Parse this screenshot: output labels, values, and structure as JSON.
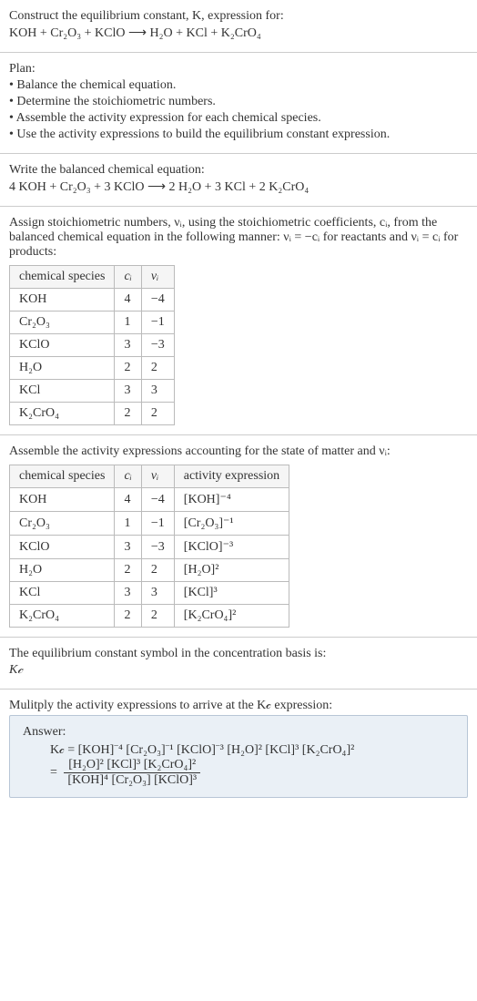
{
  "intro": {
    "line1": "Construct the equilibrium constant, K, expression for:",
    "line2": "KOH + Cr₂O₃ + KClO ⟶ H₂O + KCl + K₂CrO₄"
  },
  "plan": {
    "heading": "Plan:",
    "b1": "• Balance the chemical equation.",
    "b2": "• Determine the stoichiometric numbers.",
    "b3": "• Assemble the activity expression for each chemical species.",
    "b4": "• Use the activity expressions to build the equilibrium constant expression."
  },
  "balanced": {
    "heading": "Write the balanced chemical equation:",
    "eq": "4 KOH + Cr₂O₃ + 3 KClO ⟶ 2 H₂O + 3 KCl + 2 K₂CrO₄"
  },
  "assign": {
    "text": "Assign stoichiometric numbers, νᵢ, using the stoichiometric coefficients, cᵢ, from the balanced chemical equation in the following manner: νᵢ = −cᵢ for reactants and νᵢ = cᵢ for products:",
    "h_species": "chemical species",
    "h_c": "cᵢ",
    "h_v": "νᵢ",
    "r0s": "KOH",
    "r0c": "4",
    "r0v": "−4",
    "r1s": "Cr₂O₃",
    "r1c": "1",
    "r1v": "−1",
    "r2s": "KClO",
    "r2c": "3",
    "r2v": "−3",
    "r3s": "H₂O",
    "r3c": "2",
    "r3v": "2",
    "r4s": "KCl",
    "r4c": "3",
    "r4v": "3",
    "r5s": "K₂CrO₄",
    "r5c": "2",
    "r5v": "2"
  },
  "activities": {
    "heading": "Assemble the activity expressions accounting for the state of matter and νᵢ:",
    "h_species": "chemical species",
    "h_c": "cᵢ",
    "h_v": "νᵢ",
    "h_a": "activity expression",
    "r0s": "KOH",
    "r0c": "4",
    "r0v": "−4",
    "r0a": "[KOH]⁻⁴",
    "r1s": "Cr₂O₃",
    "r1c": "1",
    "r1v": "−1",
    "r1a": "[Cr₂O₃]⁻¹",
    "r2s": "KClO",
    "r2c": "3",
    "r2v": "−3",
    "r2a": "[KClO]⁻³",
    "r3s": "H₂O",
    "r3c": "2",
    "r3v": "2",
    "r3a": "[H₂O]²",
    "r4s": "KCl",
    "r4c": "3",
    "r4v": "3",
    "r4a": "[KCl]³",
    "r5s": "K₂CrO₄",
    "r5c": "2",
    "r5v": "2",
    "r5a": "[K₂CrO₄]²"
  },
  "symbol": {
    "line1": "The equilibrium constant symbol in the concentration basis is:",
    "line2": "K𝒸"
  },
  "multiply": {
    "heading": "Mulitply the activity expressions to arrive at the K𝒸 expression:"
  },
  "answer": {
    "label": "Answer:",
    "line1": "K𝒸 = [KOH]⁻⁴ [Cr₂O₃]⁻¹ [KClO]⁻³ [H₂O]² [KCl]³ [K₂CrO₄]²",
    "eq": "=",
    "num": "[H₂O]² [KCl]³ [K₂CrO₄]²",
    "den": "[KOH]⁴ [Cr₂O₃] [KClO]³"
  },
  "chart_data": {
    "type": "table",
    "tables": [
      {
        "title": "stoichiometric numbers",
        "columns": [
          "chemical species",
          "c_i",
          "ν_i"
        ],
        "rows": [
          [
            "KOH",
            4,
            -4
          ],
          [
            "Cr2O3",
            1,
            -1
          ],
          [
            "KClO",
            3,
            -3
          ],
          [
            "H2O",
            2,
            2
          ],
          [
            "KCl",
            3,
            3
          ],
          [
            "K2CrO4",
            2,
            2
          ]
        ]
      },
      {
        "title": "activity expressions",
        "columns": [
          "chemical species",
          "c_i",
          "ν_i",
          "activity expression"
        ],
        "rows": [
          [
            "KOH",
            4,
            -4,
            "[KOH]^-4"
          ],
          [
            "Cr2O3",
            1,
            -1,
            "[Cr2O3]^-1"
          ],
          [
            "KClO",
            3,
            -3,
            "[KClO]^-3"
          ],
          [
            "H2O",
            2,
            2,
            "[H2O]^2"
          ],
          [
            "KCl",
            3,
            3,
            "[KCl]^3"
          ],
          [
            "K2CrO4",
            2,
            2,
            "[K2CrO4]^2"
          ]
        ]
      }
    ]
  }
}
